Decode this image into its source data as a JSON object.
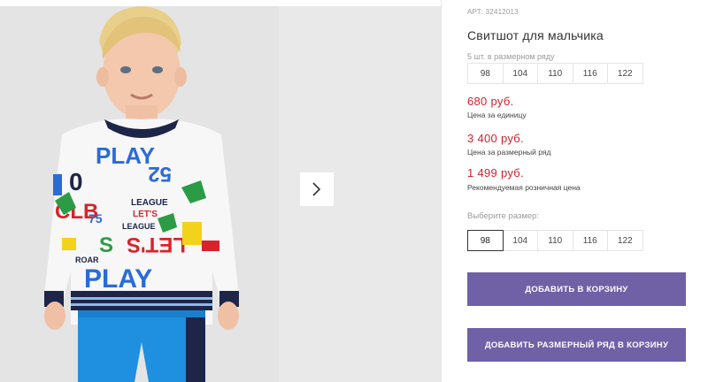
{
  "product": {
    "article": "АРТ: 32412013",
    "title": "Свитшот для мальчика"
  },
  "pack": {
    "label": "5 шт. в размерном ряду",
    "sizes": [
      "98",
      "104",
      "110",
      "116",
      "122"
    ]
  },
  "prices": [
    {
      "value": "680 руб.",
      "label": "Цена за единицу"
    },
    {
      "value": "3 400 руб.",
      "label": "Цена за размерный ряд"
    },
    {
      "value": "1 499 руб.",
      "label": "Рекомендуемая розничная цена"
    }
  ],
  "size_picker": {
    "label": "Выберите размер:",
    "sizes": [
      "98",
      "104",
      "110",
      "116",
      "122"
    ],
    "selected": "98"
  },
  "buttons": {
    "add_to_cart": "Добавить в корзину",
    "add_pack_to_cart": "Добавить размерный ряд в корзину"
  },
  "sweatshirt_print": {
    "words": [
      "PLAY",
      "LET'S",
      "LEAGUE",
      "ROAR",
      "75",
      "CLUB"
    ]
  },
  "colors": {
    "accent_button": "#7060a6",
    "price_red": "#d4202c"
  },
  "icons": {
    "gallery_next": "chevron-right-icon"
  }
}
